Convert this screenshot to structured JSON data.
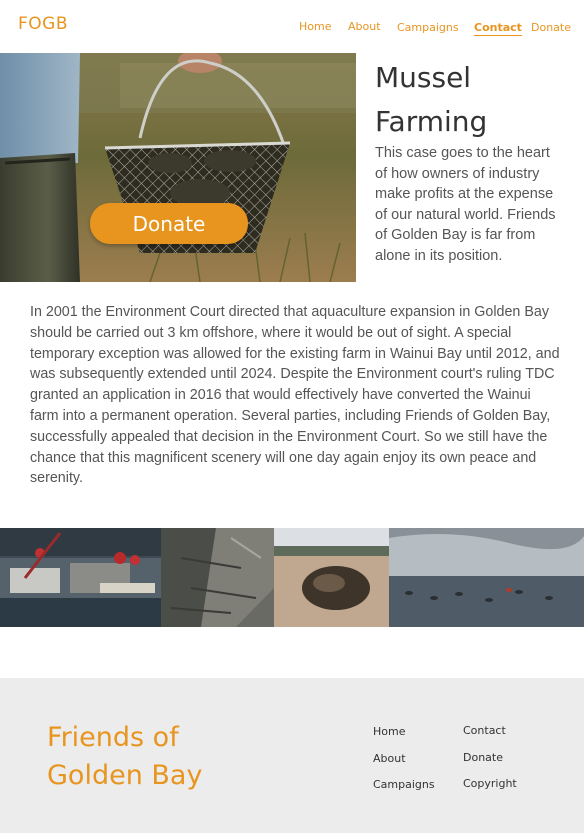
{
  "brand": {
    "logo": "FOGB",
    "accent_color": "#e8951f"
  },
  "nav": {
    "home": "Home",
    "about": "About",
    "campaigns": "Campaigns",
    "contact": "Contact",
    "donate": "Donate",
    "active": "Contact"
  },
  "hero": {
    "donate_label": "Donate",
    "image_icon": "mussel-basket-photo"
  },
  "article": {
    "title_line1": "Mussel",
    "title_line2": "Farming",
    "intro": "This case goes to the heart of how owners of industry make profits at the expense of our natural world.  Friends of Golden Bay is far from alone in its position.",
    "body": "In 2001 the Environment Court directed that aquaculture expansion in Golden Bay should be carried out 3 km offshore, where it would be out of sight.  A special temporary exception was allowed for the existing farm in Wainui Bay until 2012, and was subsequently extended until 2024.  Despite the Environment court's ruling TDC granted an application in 2016 that would effectively have converted the Wainui farm into a permanent operation.  Several parties, including Friends of Golden Bay, successfully appealed that decision in the Environment Court.  So we still have the chance that this magnificent scenery will one day again enjoy its own peace and serenity."
  },
  "gallery": {
    "images": [
      "harbour-boats-photo",
      "rocks-photo",
      "beach-mussel-photo",
      "bay-buoys-photo"
    ]
  },
  "footer": {
    "brand_line1": "Friends of",
    "brand_line2": "Golden Bay",
    "links": {
      "home": "Home",
      "about": "About",
      "campaigns": "Campaigns",
      "contact": "Contact",
      "donate": "Donate",
      "copyright": "Copyright"
    }
  }
}
